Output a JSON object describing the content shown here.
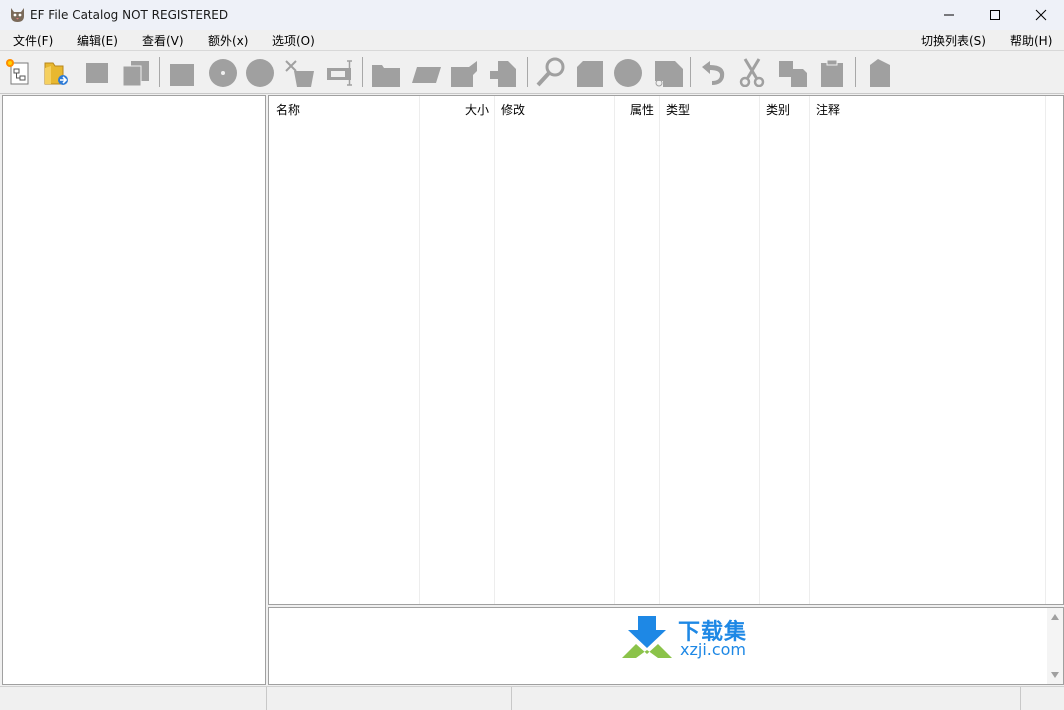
{
  "window": {
    "title": "EF File Catalog NOT REGISTERED"
  },
  "menu": {
    "file": "文件(F)",
    "edit": "编辑(E)",
    "view": "查看(V)",
    "extra": "额外(x)",
    "options": "选项(O)",
    "switch_list": "切换列表(S)",
    "help": "帮助(H)"
  },
  "toolbar": {
    "icons": [
      "new-catalog-icon",
      "open-folder-icon",
      "disabled-square-icon",
      "disabled-copy-icon",
      "disabled-drive-icon",
      "disabled-cd-icon",
      "disabled-disk-icon",
      "disabled-scan-icon",
      "disabled-label-icon",
      "disabled-folder-icon",
      "disabled-rename-icon",
      "disabled-tag-icon",
      "disabled-puzzle-icon",
      "disabled-search-icon",
      "disabled-page-icon",
      "disabled-circle-icon",
      "disabled-link-icon",
      "disabled-undo-icon",
      "disabled-cut-icon",
      "disabled-copy2-icon",
      "disabled-paste-icon",
      "disabled-properties-icon"
    ]
  },
  "list": {
    "columns": [
      "名称",
      "大小",
      "修改",
      "属性",
      "类型",
      "类别",
      "注释"
    ]
  },
  "watermark": {
    "cn": "下载集",
    "en": "xzji.com"
  },
  "colors": {
    "disabled_icon": "#a0a0a0",
    "accent": "#1e88e5",
    "watermark_green": "#8bc34a"
  }
}
